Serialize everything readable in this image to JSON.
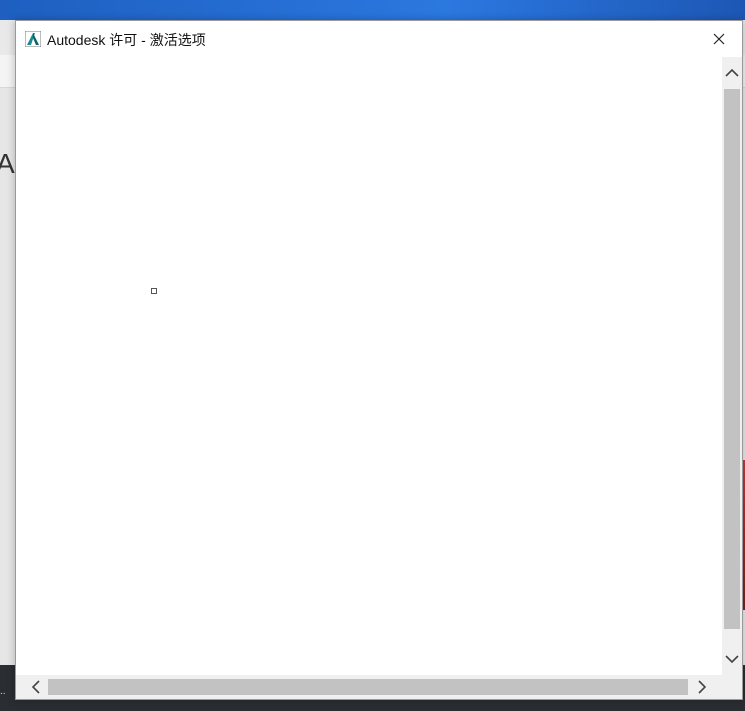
{
  "window": {
    "title": "Autodesk 许可 - 激活选项",
    "app_icon": "autodesk-a-icon",
    "close_icon": "close-icon"
  },
  "background": {
    "partial_letter": "A",
    "taskbar_text": ".."
  },
  "scrollbars": {
    "vertical": {
      "up_icon": "chevron-up-icon",
      "down_icon": "chevron-down-icon"
    },
    "horizontal": {
      "left_icon": "chevron-left-icon",
      "right_icon": "chevron-right-icon"
    }
  },
  "colors": {
    "desktop_accent": "#2b78e0",
    "icon_teal": "#1a8a8f",
    "taskbar": "#2a2d31"
  }
}
